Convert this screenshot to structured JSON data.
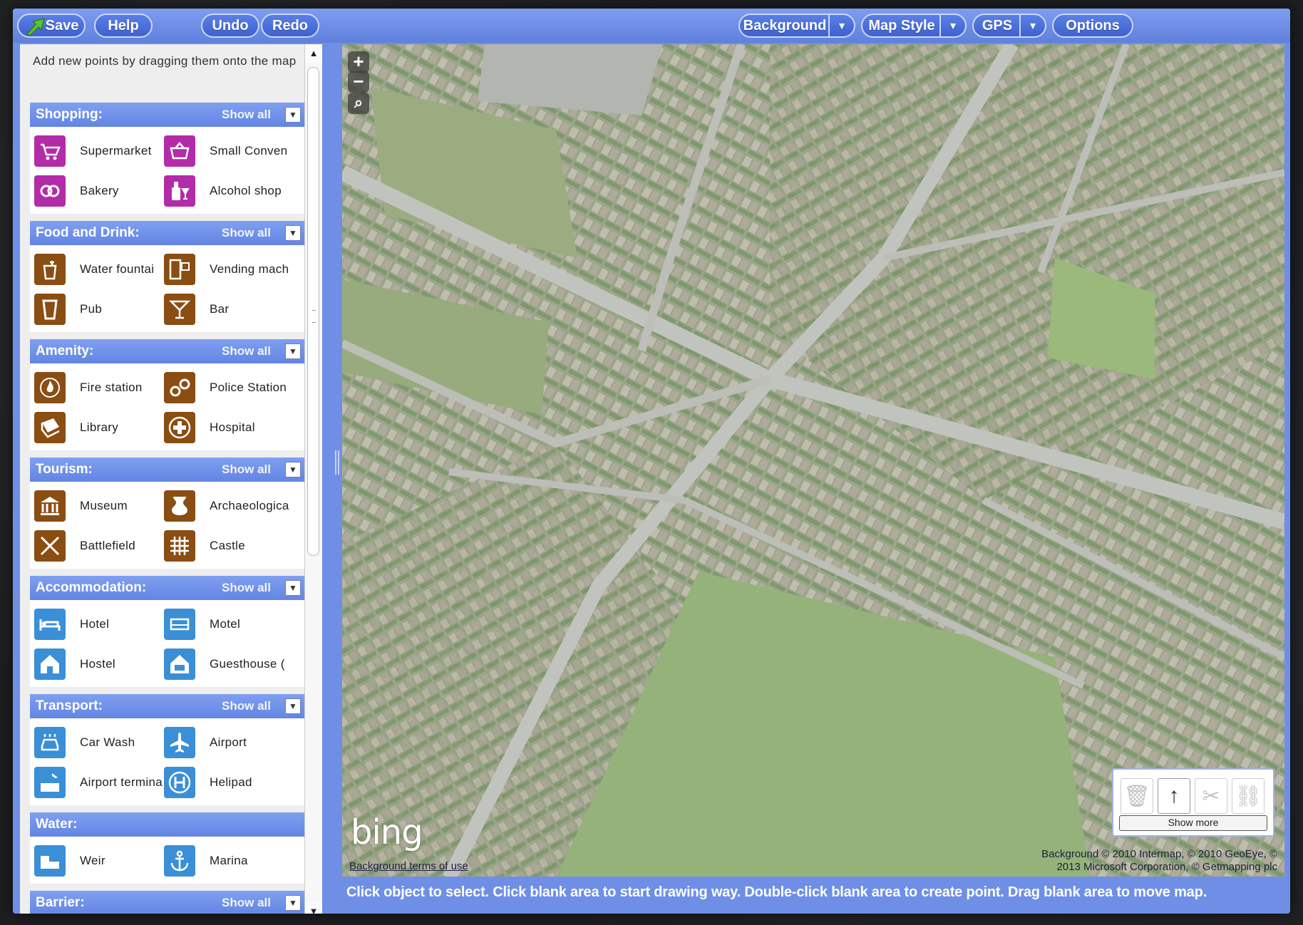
{
  "toolbar": {
    "save": "Save",
    "help": "Help",
    "undo": "Undo",
    "redo": "Redo",
    "background": "Background",
    "map_style": "Map Style",
    "gps": "GPS",
    "options": "Options",
    "dropdown_glyph": "▼"
  },
  "sidebar": {
    "intro": "Add new points by dragging them onto the map",
    "show_all": "Show all",
    "toggle_glyph": "▼",
    "categories": [
      {
        "title": "Shopping:",
        "items": [
          {
            "label": "Supermarket",
            "icon": "shopping-cart-icon",
            "color": "#b42ba8"
          },
          {
            "label": "Small Conven",
            "icon": "basket-icon",
            "color": "#b42ba8"
          },
          {
            "label": "Bakery",
            "icon": "pretzel-icon",
            "color": "#b42ba8"
          },
          {
            "label": "Alcohol shop",
            "icon": "bottle-glass-icon",
            "color": "#b42ba8"
          }
        ]
      },
      {
        "title": "Food and Drink:",
        "items": [
          {
            "label": "Water fountai",
            "icon": "water-fountain-icon",
            "color": "#8a4d12"
          },
          {
            "label": "Vending mach",
            "icon": "vending-machine-icon",
            "color": "#8a4d12"
          },
          {
            "label": "Pub",
            "icon": "pint-glass-icon",
            "color": "#8a4d12"
          },
          {
            "label": "Bar",
            "icon": "cocktail-glass-icon",
            "color": "#8a4d12"
          }
        ]
      },
      {
        "title": "Amenity:",
        "items": [
          {
            "label": "Fire station",
            "icon": "fire-station-icon",
            "color": "#8a4d12"
          },
          {
            "label": "Police Station",
            "icon": "handcuffs-icon",
            "color": "#8a4d12"
          },
          {
            "label": "Library",
            "icon": "book-icon",
            "color": "#8a4d12"
          },
          {
            "label": "Hospital",
            "icon": "medical-cross-icon",
            "color": "#8a4d12"
          }
        ]
      },
      {
        "title": "Tourism:",
        "items": [
          {
            "label": "Museum",
            "icon": "museum-icon",
            "color": "#8a4d12"
          },
          {
            "label": "Archaeologica",
            "icon": "vase-icon",
            "color": "#8a4d12"
          },
          {
            "label": "Battlefield",
            "icon": "crossed-swords-icon",
            "color": "#8a4d12"
          },
          {
            "label": "Castle",
            "icon": "castle-grid-icon",
            "color": "#8a4d12"
          }
        ]
      },
      {
        "title": "Accommodation:",
        "items": [
          {
            "label": "Hotel",
            "icon": "hotel-bed-icon",
            "color": "#3a8fd7"
          },
          {
            "label": "Motel",
            "icon": "motel-icon",
            "color": "#3a8fd7"
          },
          {
            "label": "Hostel",
            "icon": "hostel-icon",
            "color": "#3a8fd7"
          },
          {
            "label": "Guesthouse (",
            "icon": "guesthouse-icon",
            "color": "#3a8fd7"
          }
        ]
      },
      {
        "title": "Transport:",
        "items": [
          {
            "label": "Car Wash",
            "icon": "car-wash-icon",
            "color": "#3a8fd7"
          },
          {
            "label": "Airport",
            "icon": "airplane-icon",
            "color": "#3a8fd7"
          },
          {
            "label": "Airport termina",
            "icon": "airport-terminal-icon",
            "color": "#3a8fd7"
          },
          {
            "label": "Helipad",
            "icon": "helipad-icon",
            "color": "#3a8fd7"
          }
        ]
      },
      {
        "title": "Water:",
        "items": [
          {
            "label": "Weir",
            "icon": "weir-icon",
            "color": "#3a8fd7"
          },
          {
            "label": "Marina",
            "icon": "anchor-icon",
            "color": "#3a8fd7"
          }
        ]
      },
      {
        "title": "Barrier:",
        "items": []
      }
    ]
  },
  "map": {
    "zoom_in": "+",
    "zoom_out": "−",
    "search": "⌕",
    "logo": "bing",
    "terms": "Background terms of use",
    "attribution_line1": "Background © 2010 Intermap, © 2010 GeoEye, ©",
    "attribution_line2": "2013 Microsoft Corporation, © Getmapping plc",
    "show_more": "Show more",
    "tools": [
      "trash-icon",
      "arrow-up-icon",
      "scissors-icon",
      "link-icon"
    ]
  },
  "statusbar": {
    "text": "Click object to select. Click blank area to start drawing way. Double-click blank area to create point. Drag blank area to move map."
  },
  "colors": {
    "chrome_blue": "#6f8fe6",
    "shopping_magenta": "#b42ba8",
    "amenity_brown": "#8a4d12",
    "transport_blue": "#3a8fd7"
  }
}
